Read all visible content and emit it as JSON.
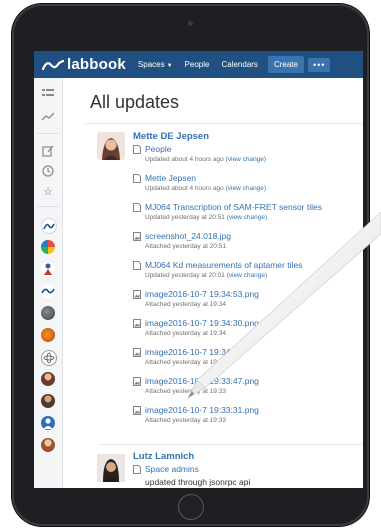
{
  "nav": {
    "logo_text": "labbook",
    "items": [
      "Spaces",
      "People",
      "Calendars"
    ],
    "create_label": "Create",
    "more_label": "•••"
  },
  "page_title": "All updates",
  "groups": [
    {
      "author": "Mette DE Jepsen",
      "rows": [
        {
          "title": "People",
          "meta": "Updated about 4 hours ago",
          "link": "(view change)"
        },
        {
          "title": "Mette Jepsen",
          "meta": "Updated about 4 hours ago",
          "link": "(view change)"
        },
        {
          "title": "MJ064 Transcription of SAM-FRET sensor tiles",
          "meta": "Updated yesterday at 20:51",
          "link": "(view change)"
        },
        {
          "title": "screenshot_24.018.jpg",
          "meta": "Attached yesterday at 20:51",
          "link": ""
        },
        {
          "title": "MJ064 Kd measurements of aptamer tiles",
          "meta": "Updated yesterday at 20:01",
          "link": "(view change)"
        },
        {
          "title": "image2016-10-7 19:34:53.png",
          "meta": "Attached yesterday at 19:34",
          "link": ""
        },
        {
          "title": "image2016-10-7 19:34:30.png",
          "meta": "Attached yesterday at 19:34",
          "link": ""
        },
        {
          "title": "image2016-10-7 19:34:0",
          "meta": "Attached yesterday at 19",
          "link": ""
        },
        {
          "title": "image2016-10-7 19:33:47.png",
          "meta": "Attached yesterday at 19:33",
          "link": ""
        },
        {
          "title": "image2016-10-7 19:33:31.png",
          "meta": "Attached yesterday at 19:33",
          "link": ""
        }
      ]
    },
    {
      "author": "Lutz Lamnich",
      "rows": [
        {
          "title": "Space admins",
          "meta": "",
          "link": ""
        }
      ],
      "note": "updated through jsonrpc api"
    }
  ],
  "colors": {
    "nav_bg": "#205081",
    "link": "#3572b0",
    "meta": "#707070"
  }
}
